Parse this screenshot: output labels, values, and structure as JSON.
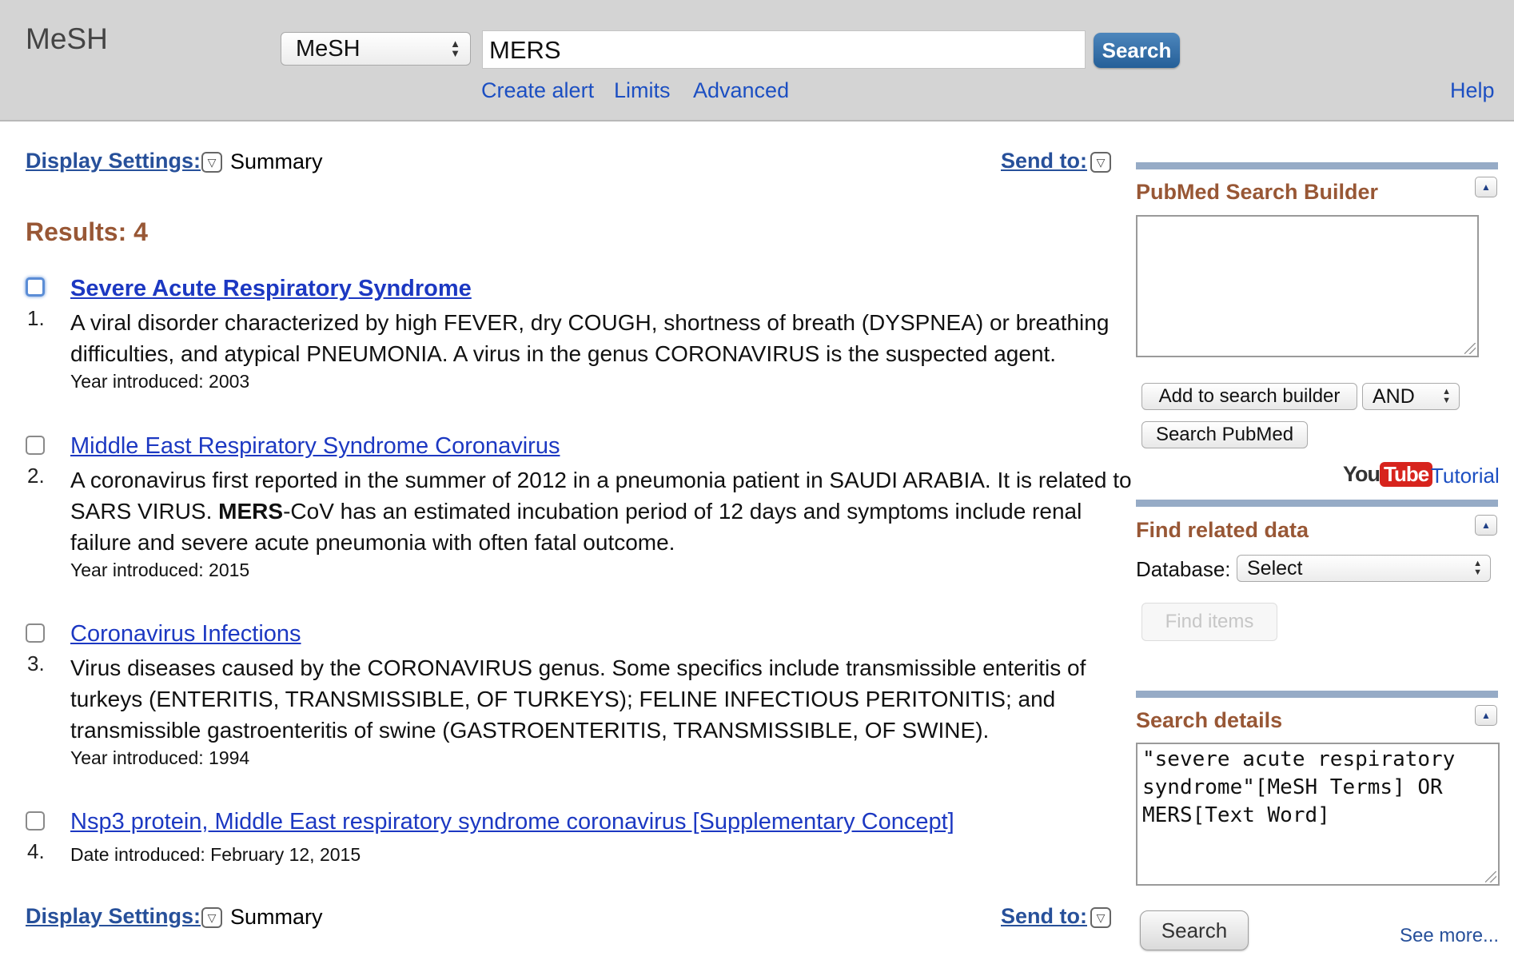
{
  "header": {
    "brand": "MeSH",
    "database_select": "MeSH",
    "search_value": "MERS",
    "search_button": "Search",
    "links": {
      "create_alert": "Create alert",
      "limits": "Limits",
      "advanced": "Advanced",
      "help": "Help"
    }
  },
  "display_settings": {
    "label": "Display Settings:",
    "value": "Summary",
    "send_to": "Send to:"
  },
  "results": {
    "count_label": "Results: 4",
    "items": [
      {
        "number": "1.",
        "title": "Severe Acute Respiratory Syndrome",
        "description": "A viral disorder characterized by high FEVER, dry COUGH, shortness of breath (DYSPNEA) or breathing difficulties, and atypical PNEUMONIA. A virus in the genus CORONAVIRUS is the suspected agent.",
        "meta": "Year introduced: 2003"
      },
      {
        "number": "2.",
        "title": "Middle East Respiratory Syndrome Coronavirus",
        "description_before": "A coronavirus first reported in the summer of 2012 in a pneumonia patient in SAUDI ARABIA. It is related to SARS VIRUS. ",
        "description_bold": "MERS",
        "description_after": "-CoV has an estimated incubation period of 12 days and symptoms include renal failure and severe acute pneumonia with often fatal outcome.",
        "meta": "Year introduced: 2015"
      },
      {
        "number": "3.",
        "title": "Coronavirus Infections",
        "description": "Virus diseases caused by the CORONAVIRUS genus. Some specifics include transmissible enteritis of turkeys (ENTERITIS, TRANSMISSIBLE, OF TURKEYS); FELINE INFECTIOUS PERITONITIS; and transmissible gastroenteritis of swine (GASTROENTERITIS, TRANSMISSIBLE, OF SWINE).",
        "meta": "Year introduced: 1994"
      },
      {
        "number": "4.",
        "title": "Nsp3 protein, Middle East respiratory syndrome coronavirus [Supplementary Concept]",
        "meta": "Date introduced: February 12, 2015"
      }
    ]
  },
  "sidebar": {
    "builder": {
      "title": "PubMed Search Builder",
      "add_button": "Add to search builder",
      "operator": "AND",
      "search_pubmed": "Search PubMed",
      "youtube_you": "You",
      "youtube_tube": "Tube",
      "tutorial": "Tutorial"
    },
    "related": {
      "title": "Find related data",
      "database_label": "Database:",
      "database_select": "Select",
      "find_button": "Find items"
    },
    "details": {
      "title": "Search details",
      "query": "\"severe acute respiratory syndrome\"[MeSH Terms] OR MERS[Text Word]",
      "search_button": "Search",
      "see_more": "See more..."
    }
  }
}
